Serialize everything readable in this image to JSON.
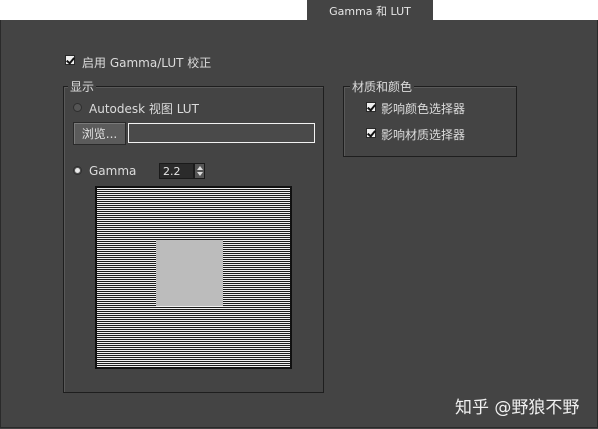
{
  "tab": {
    "label": "Gamma 和 LUT"
  },
  "enable_checkbox": {
    "label": "启用 Gamma/LUT 校正",
    "checked": true
  },
  "display_group": {
    "title": "显示",
    "autodesk_radio": {
      "label": "Autodesk 视图 LUT",
      "selected": false
    },
    "browse_button": {
      "label": "浏览..."
    },
    "lut_path": {
      "value": ""
    },
    "gamma_radio": {
      "label": "Gamma",
      "selected": true
    },
    "gamma_value": "2.2"
  },
  "material_group": {
    "title": "材质和颜色",
    "affect_color_picker": {
      "label": "影响颜色选择器",
      "checked": true
    },
    "affect_material_picker": {
      "label": "影响材质选择器",
      "checked": true
    }
  },
  "watermark": "知乎 @野狼不野"
}
